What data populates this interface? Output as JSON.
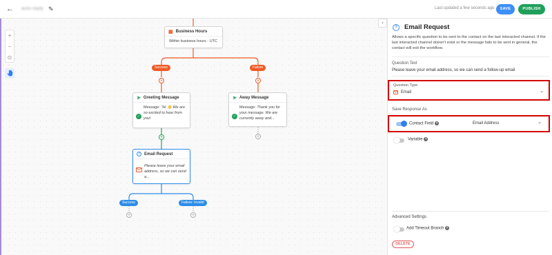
{
  "header": {
    "workflow_name": "auto-reply",
    "updated_text": "Last updated a few seconds ago",
    "save_label": "SAVE",
    "publish_label": "PUBLISH"
  },
  "canvas": {
    "zoom": {
      "in": "+",
      "out": "−",
      "fit": "⊙"
    },
    "nodes": {
      "business_hours": {
        "title": "Business Hours",
        "body": "Within business hours - UTC"
      },
      "greeting": {
        "title": "Greeting Message",
        "body_prefix": "Message: ",
        "body": "\"Hi 👋 We are so excited to hear from you!\"",
        "body_l1": "\"Hi 👋 We are",
        "body_l2": "so excited to hear from",
        "body_l3": "you!"
      },
      "away": {
        "title": "Away Message",
        "body_prefix": "Message: ",
        "body_l1": "Thank you for",
        "body_l2": "your message. We are",
        "body_l3": "currently away and..."
      },
      "email_request": {
        "title": "Email Request",
        "body_l1": "Please leave your email",
        "body_l2": "address, so we can send",
        "body_l3": "a..."
      }
    },
    "branches": {
      "success": "Success",
      "failure": "Failure",
      "email_success": "Success",
      "email_failure": "Failure: Invalid"
    }
  },
  "panel": {
    "title": "Email Request",
    "description": "Allows a specific question to be sent to the contact on the last interacted channel. If the last interacted channel doesn't exist or the message fails to be sent in general, the contact will exit the workflow.",
    "question_text_label": "Question Text",
    "question_text_value": "Please leave your email address, so we can send a follow-up email",
    "question_type_label": "Question Type",
    "question_type_value": "Email",
    "save_response_label": "Save Response As",
    "contact_field_label": "Contact Field",
    "contact_field_value": "Email Address",
    "contact_field_enabled": true,
    "variable_label": "Variable",
    "variable_enabled": false,
    "advanced_label": "Advanced Settings",
    "timeout_label": "Add Timeout Branch",
    "timeout_enabled": false,
    "delete_label": "DELETE"
  },
  "colors": {
    "primary": "#3d8ef5",
    "publish": "#1fa05a",
    "branch_orange": "#ef5a24",
    "branch_blue": "#2d8ce8",
    "success_green": "#1fa05a",
    "highlight_red": "#d40000"
  }
}
